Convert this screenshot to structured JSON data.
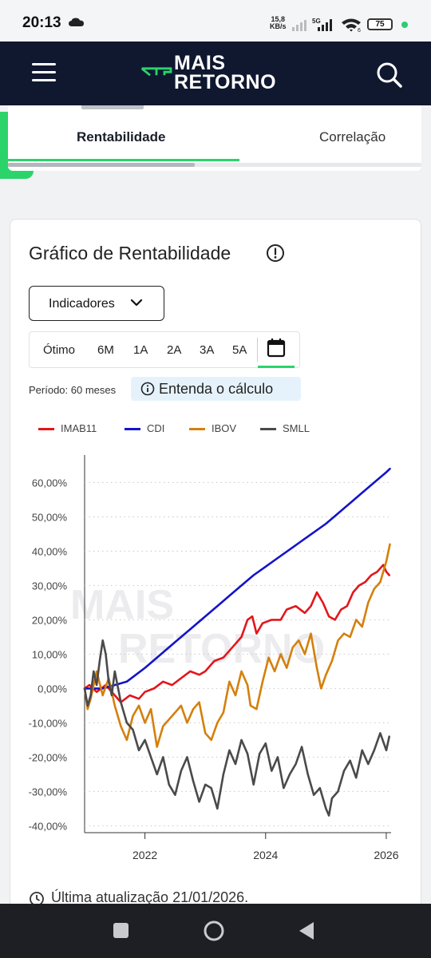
{
  "status": {
    "time": "20:13",
    "net_speed_value": "15,8",
    "net_speed_unit": "KB/s",
    "signal_label": "5G",
    "wifi_label": "6",
    "battery": "75"
  },
  "header": {
    "logo_line1": "MAIS",
    "logo_line2": "RETORNO"
  },
  "tabs": [
    {
      "label": "Rentabilidade",
      "active": true
    },
    {
      "label": "Correlação",
      "active": false
    }
  ],
  "card": {
    "title": "Gráfico de Rentabilidade",
    "dropdown_label": "Indicadores",
    "periods": [
      "Ótimo",
      "6M",
      "1A",
      "2A",
      "3A",
      "5A"
    ],
    "period_text": "Período: 60 meses",
    "explain_label": "Entenda o cálculo",
    "last_update": "Última atualização 21/01/2026.",
    "watermark_line1": "MAIS",
    "watermark_line2": "RETORNO"
  },
  "colors": {
    "brand_green": "#2bd46b",
    "header_navy": "#101830"
  },
  "chart_data": {
    "type": "line",
    "ylim": [
      -42,
      68
    ],
    "yticks": [
      60,
      50,
      40,
      30,
      20,
      10,
      0,
      -10,
      -20,
      -30,
      -40
    ],
    "ytick_labels": [
      "60,00%",
      "50,00%",
      "40,00%",
      "30,00%",
      "20,00%",
      "10,00%",
      "0,00%",
      "-10,00%",
      "-20,00%",
      "-30,00%",
      "-40,00%"
    ],
    "xlim": [
      2021.0,
      2026.08
    ],
    "xticks": [
      2022,
      2024,
      2026
    ],
    "xtick_labels": [
      "2022",
      "2024",
      "2026"
    ],
    "series": [
      {
        "name": "IMAB11",
        "color": "#e3161b",
        "points": [
          [
            2021.0,
            0
          ],
          [
            2021.08,
            1
          ],
          [
            2021.2,
            -1
          ],
          [
            2021.35,
            1
          ],
          [
            2021.5,
            -2
          ],
          [
            2021.6,
            -4
          ],
          [
            2021.75,
            -2
          ],
          [
            2021.9,
            -3
          ],
          [
            2022.0,
            -1
          ],
          [
            2022.15,
            0
          ],
          [
            2022.3,
            2
          ],
          [
            2022.45,
            1
          ],
          [
            2022.6,
            3
          ],
          [
            2022.75,
            5
          ],
          [
            2022.9,
            4
          ],
          [
            2023.0,
            5
          ],
          [
            2023.15,
            8
          ],
          [
            2023.3,
            9
          ],
          [
            2023.45,
            12
          ],
          [
            2023.6,
            15
          ],
          [
            2023.7,
            20
          ],
          [
            2023.78,
            21
          ],
          [
            2023.85,
            16
          ],
          [
            2023.95,
            19
          ],
          [
            2024.1,
            20
          ],
          [
            2024.25,
            20
          ],
          [
            2024.35,
            23
          ],
          [
            2024.5,
            24
          ],
          [
            2024.65,
            22
          ],
          [
            2024.75,
            24
          ],
          [
            2024.85,
            28
          ],
          [
            2024.95,
            25
          ],
          [
            2025.05,
            21
          ],
          [
            2025.15,
            20
          ],
          [
            2025.25,
            23
          ],
          [
            2025.35,
            24
          ],
          [
            2025.45,
            28
          ],
          [
            2025.55,
            30
          ],
          [
            2025.65,
            31
          ],
          [
            2025.75,
            33
          ],
          [
            2025.85,
            34
          ],
          [
            2025.95,
            36
          ],
          [
            2026.0,
            34
          ],
          [
            2026.05,
            33
          ]
        ]
      },
      {
        "name": "CDI",
        "color": "#1414c8",
        "points": [
          [
            2021.0,
            0
          ],
          [
            2021.3,
            0
          ],
          [
            2021.5,
            1
          ],
          [
            2021.7,
            2
          ],
          [
            2021.85,
            4
          ],
          [
            2022.0,
            6
          ],
          [
            2022.2,
            9
          ],
          [
            2022.4,
            12
          ],
          [
            2022.6,
            15
          ],
          [
            2022.8,
            18
          ],
          [
            2023.0,
            21
          ],
          [
            2023.2,
            24
          ],
          [
            2023.4,
            27
          ],
          [
            2023.6,
            30
          ],
          [
            2023.8,
            33
          ],
          [
            2024.0,
            35.5
          ],
          [
            2024.2,
            38
          ],
          [
            2024.4,
            40.5
          ],
          [
            2024.6,
            43
          ],
          [
            2024.8,
            45.5
          ],
          [
            2025.0,
            48
          ],
          [
            2025.2,
            51
          ],
          [
            2025.4,
            54
          ],
          [
            2025.6,
            57
          ],
          [
            2025.8,
            60
          ],
          [
            2026.0,
            63
          ],
          [
            2026.06,
            64
          ]
        ]
      },
      {
        "name": "IBOV",
        "color": "#d4800c",
        "points": [
          [
            2021.0,
            0
          ],
          [
            2021.05,
            -6
          ],
          [
            2021.1,
            -3
          ],
          [
            2021.2,
            5
          ],
          [
            2021.3,
            -2
          ],
          [
            2021.4,
            3
          ],
          [
            2021.5,
            -5
          ],
          [
            2021.6,
            -11
          ],
          [
            2021.7,
            -15
          ],
          [
            2021.8,
            -8
          ],
          [
            2021.9,
            -5
          ],
          [
            2022.0,
            -10
          ],
          [
            2022.1,
            -6
          ],
          [
            2022.2,
            -17
          ],
          [
            2022.3,
            -11
          ],
          [
            2022.4,
            -9
          ],
          [
            2022.5,
            -7
          ],
          [
            2022.6,
            -5
          ],
          [
            2022.7,
            -10
          ],
          [
            2022.8,
            -6
          ],
          [
            2022.9,
            -4
          ],
          [
            2023.0,
            -13
          ],
          [
            2023.1,
            -15
          ],
          [
            2023.2,
            -10
          ],
          [
            2023.3,
            -7
          ],
          [
            2023.4,
            2
          ],
          [
            2023.5,
            -2
          ],
          [
            2023.6,
            5
          ],
          [
            2023.7,
            1
          ],
          [
            2023.75,
            -5
          ],
          [
            2023.85,
            -6
          ],
          [
            2023.95,
            2
          ],
          [
            2024.05,
            9
          ],
          [
            2024.15,
            5
          ],
          [
            2024.25,
            10
          ],
          [
            2024.35,
            6
          ],
          [
            2024.45,
            12
          ],
          [
            2024.55,
            14
          ],
          [
            2024.65,
            10
          ],
          [
            2024.75,
            16
          ],
          [
            2024.85,
            6
          ],
          [
            2024.92,
            0
          ],
          [
            2025.0,
            4
          ],
          [
            2025.1,
            8
          ],
          [
            2025.2,
            14
          ],
          [
            2025.3,
            16
          ],
          [
            2025.4,
            15
          ],
          [
            2025.5,
            20
          ],
          [
            2025.6,
            18
          ],
          [
            2025.7,
            25
          ],
          [
            2025.8,
            29
          ],
          [
            2025.9,
            31
          ],
          [
            2026.0,
            37
          ],
          [
            2026.06,
            42
          ]
        ]
      },
      {
        "name": "SMLL",
        "color": "#4a4a4a",
        "points": [
          [
            2021.0,
            0
          ],
          [
            2021.05,
            -5
          ],
          [
            2021.1,
            -2
          ],
          [
            2021.15,
            5
          ],
          [
            2021.2,
            1
          ],
          [
            2021.25,
            8
          ],
          [
            2021.3,
            14
          ],
          [
            2021.35,
            10
          ],
          [
            2021.4,
            2
          ],
          [
            2021.45,
            -2
          ],
          [
            2021.5,
            5
          ],
          [
            2021.6,
            -4
          ],
          [
            2021.7,
            -10
          ],
          [
            2021.8,
            -12
          ],
          [
            2021.9,
            -18
          ],
          [
            2022.0,
            -15
          ],
          [
            2022.1,
            -20
          ],
          [
            2022.2,
            -25
          ],
          [
            2022.3,
            -20
          ],
          [
            2022.4,
            -28
          ],
          [
            2022.5,
            -31
          ],
          [
            2022.6,
            -24
          ],
          [
            2022.7,
            -20
          ],
          [
            2022.8,
            -27
          ],
          [
            2022.9,
            -33
          ],
          [
            2023.0,
            -28
          ],
          [
            2023.1,
            -29
          ],
          [
            2023.2,
            -35
          ],
          [
            2023.3,
            -25
          ],
          [
            2023.4,
            -18
          ],
          [
            2023.5,
            -22
          ],
          [
            2023.6,
            -15
          ],
          [
            2023.7,
            -19
          ],
          [
            2023.8,
            -28
          ],
          [
            2023.9,
            -19
          ],
          [
            2024.0,
            -16
          ],
          [
            2024.1,
            -24
          ],
          [
            2024.2,
            -20
          ],
          [
            2024.3,
            -29
          ],
          [
            2024.4,
            -25
          ],
          [
            2024.5,
            -22
          ],
          [
            2024.6,
            -17
          ],
          [
            2024.7,
            -25
          ],
          [
            2024.8,
            -31
          ],
          [
            2024.9,
            -29
          ],
          [
            2025.0,
            -35
          ],
          [
            2025.05,
            -37
          ],
          [
            2025.1,
            -32
          ],
          [
            2025.2,
            -30
          ],
          [
            2025.3,
            -24
          ],
          [
            2025.4,
            -21
          ],
          [
            2025.5,
            -26
          ],
          [
            2025.6,
            -18
          ],
          [
            2025.7,
            -22
          ],
          [
            2025.8,
            -18
          ],
          [
            2025.9,
            -13
          ],
          [
            2026.0,
            -18
          ],
          [
            2026.05,
            -14
          ]
        ]
      }
    ]
  }
}
